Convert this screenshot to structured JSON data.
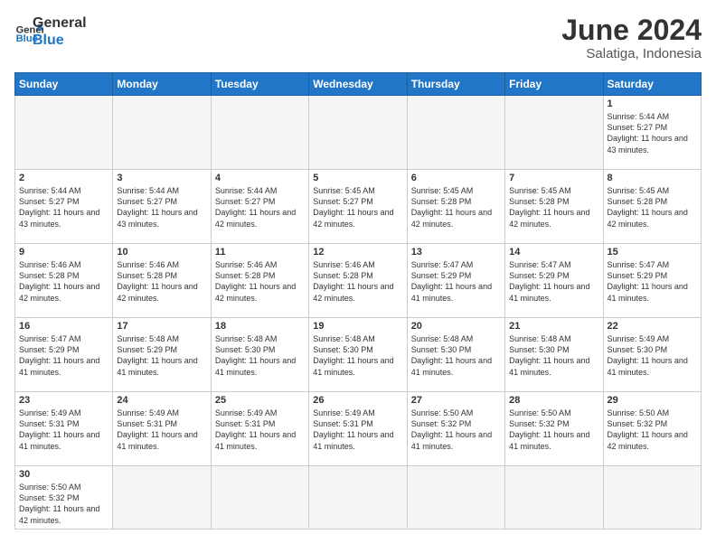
{
  "header": {
    "logo_general": "General",
    "logo_blue": "Blue",
    "month_title": "June 2024",
    "location": "Salatiga, Indonesia"
  },
  "weekdays": [
    "Sunday",
    "Monday",
    "Tuesday",
    "Wednesday",
    "Thursday",
    "Friday",
    "Saturday"
  ],
  "weeks": [
    [
      {
        "day": "",
        "info": ""
      },
      {
        "day": "",
        "info": ""
      },
      {
        "day": "",
        "info": ""
      },
      {
        "day": "",
        "info": ""
      },
      {
        "day": "",
        "info": ""
      },
      {
        "day": "",
        "info": ""
      },
      {
        "day": "1",
        "info": "Sunrise: 5:44 AM\nSunset: 5:27 PM\nDaylight: 11 hours\nand 43 minutes."
      }
    ],
    [
      {
        "day": "2",
        "info": "Sunrise: 5:44 AM\nSunset: 5:27 PM\nDaylight: 11 hours\nand 43 minutes."
      },
      {
        "day": "3",
        "info": "Sunrise: 5:44 AM\nSunset: 5:27 PM\nDaylight: 11 hours\nand 43 minutes."
      },
      {
        "day": "4",
        "info": "Sunrise: 5:44 AM\nSunset: 5:27 PM\nDaylight: 11 hours\nand 42 minutes."
      },
      {
        "day": "5",
        "info": "Sunrise: 5:45 AM\nSunset: 5:27 PM\nDaylight: 11 hours\nand 42 minutes."
      },
      {
        "day": "6",
        "info": "Sunrise: 5:45 AM\nSunset: 5:28 PM\nDaylight: 11 hours\nand 42 minutes."
      },
      {
        "day": "7",
        "info": "Sunrise: 5:45 AM\nSunset: 5:28 PM\nDaylight: 11 hours\nand 42 minutes."
      },
      {
        "day": "8",
        "info": "Sunrise: 5:45 AM\nSunset: 5:28 PM\nDaylight: 11 hours\nand 42 minutes."
      }
    ],
    [
      {
        "day": "9",
        "info": "Sunrise: 5:46 AM\nSunset: 5:28 PM\nDaylight: 11 hours\nand 42 minutes."
      },
      {
        "day": "10",
        "info": "Sunrise: 5:46 AM\nSunset: 5:28 PM\nDaylight: 11 hours\nand 42 minutes."
      },
      {
        "day": "11",
        "info": "Sunrise: 5:46 AM\nSunset: 5:28 PM\nDaylight: 11 hours\nand 42 minutes."
      },
      {
        "day": "12",
        "info": "Sunrise: 5:46 AM\nSunset: 5:28 PM\nDaylight: 11 hours\nand 42 minutes."
      },
      {
        "day": "13",
        "info": "Sunrise: 5:47 AM\nSunset: 5:29 PM\nDaylight: 11 hours\nand 41 minutes."
      },
      {
        "day": "14",
        "info": "Sunrise: 5:47 AM\nSunset: 5:29 PM\nDaylight: 11 hours\nand 41 minutes."
      },
      {
        "day": "15",
        "info": "Sunrise: 5:47 AM\nSunset: 5:29 PM\nDaylight: 11 hours\nand 41 minutes."
      }
    ],
    [
      {
        "day": "16",
        "info": "Sunrise: 5:47 AM\nSunset: 5:29 PM\nDaylight: 11 hours\nand 41 minutes."
      },
      {
        "day": "17",
        "info": "Sunrise: 5:48 AM\nSunset: 5:29 PM\nDaylight: 11 hours\nand 41 minutes."
      },
      {
        "day": "18",
        "info": "Sunrise: 5:48 AM\nSunset: 5:30 PM\nDaylight: 11 hours\nand 41 minutes."
      },
      {
        "day": "19",
        "info": "Sunrise: 5:48 AM\nSunset: 5:30 PM\nDaylight: 11 hours\nand 41 minutes."
      },
      {
        "day": "20",
        "info": "Sunrise: 5:48 AM\nSunset: 5:30 PM\nDaylight: 11 hours\nand 41 minutes."
      },
      {
        "day": "21",
        "info": "Sunrise: 5:48 AM\nSunset: 5:30 PM\nDaylight: 11 hours\nand 41 minutes."
      },
      {
        "day": "22",
        "info": "Sunrise: 5:49 AM\nSunset: 5:30 PM\nDaylight: 11 hours\nand 41 minutes."
      }
    ],
    [
      {
        "day": "23",
        "info": "Sunrise: 5:49 AM\nSunset: 5:31 PM\nDaylight: 11 hours\nand 41 minutes."
      },
      {
        "day": "24",
        "info": "Sunrise: 5:49 AM\nSunset: 5:31 PM\nDaylight: 11 hours\nand 41 minutes."
      },
      {
        "day": "25",
        "info": "Sunrise: 5:49 AM\nSunset: 5:31 PM\nDaylight: 11 hours\nand 41 minutes."
      },
      {
        "day": "26",
        "info": "Sunrise: 5:49 AM\nSunset: 5:31 PM\nDaylight: 11 hours\nand 41 minutes."
      },
      {
        "day": "27",
        "info": "Sunrise: 5:50 AM\nSunset: 5:32 PM\nDaylight: 11 hours\nand 41 minutes."
      },
      {
        "day": "28",
        "info": "Sunrise: 5:50 AM\nSunset: 5:32 PM\nDaylight: 11 hours\nand 41 minutes."
      },
      {
        "day": "29",
        "info": "Sunrise: 5:50 AM\nSunset: 5:32 PM\nDaylight: 11 hours\nand 42 minutes."
      }
    ],
    [
      {
        "day": "30",
        "info": "Sunrise: 5:50 AM\nSunset: 5:32 PM\nDaylight: 11 hours\nand 42 minutes."
      },
      {
        "day": "",
        "info": ""
      },
      {
        "day": "",
        "info": ""
      },
      {
        "day": "",
        "info": ""
      },
      {
        "day": "",
        "info": ""
      },
      {
        "day": "",
        "info": ""
      },
      {
        "day": "",
        "info": ""
      }
    ]
  ]
}
